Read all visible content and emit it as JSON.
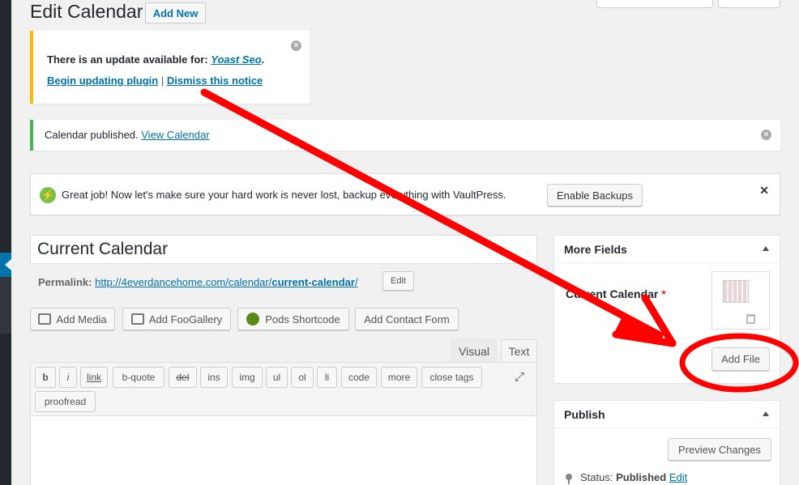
{
  "header": {
    "title": "Edit Calendar",
    "add_new": "Add New"
  },
  "notices": {
    "yoast": {
      "prefix": "There is an update available for: ",
      "plugin": "Yoast Seo",
      "suffix": ".",
      "begin": "Begin updating plugin",
      "sep": " | ",
      "dismiss": "Dismiss this notice"
    },
    "published": {
      "text": "Calendar published. ",
      "link": "View Calendar"
    },
    "vaultpress": {
      "text": "Great job! Now let's make sure your hard work is never lost, backup everything with VaultPress.",
      "button": "Enable Backups"
    }
  },
  "post": {
    "title": "Current Calendar",
    "permalink_label": "Permalink:",
    "permalink_base": "http://4everdancehome.com/calendar/",
    "permalink_slug": "current-calendar",
    "permalink_end": "/",
    "edit_label": "Edit"
  },
  "media_buttons": {
    "add_media": "Add Media",
    "add_foogallery": "Add FooGallery",
    "pods_shortcode": "Pods Shortcode",
    "add_contact_form": "Add Contact Form"
  },
  "editor_tabs": {
    "visual": "Visual",
    "text": "Text"
  },
  "quicktags": [
    "b",
    "i",
    "link",
    "b-quote",
    "del",
    "ins",
    "img",
    "ul",
    "ol",
    "li",
    "code",
    "more",
    "close tags",
    "proofread"
  ],
  "more_fields": {
    "title": "More Fields",
    "field_label": "Current Calendar",
    "required": "*",
    "add_file": "Add File"
  },
  "publish": {
    "title": "Publish",
    "preview": "Preview Changes",
    "status_label": "Status:",
    "status_value": "Published",
    "status_edit": "Edit"
  },
  "annotation": {
    "color": "#ff0000"
  }
}
